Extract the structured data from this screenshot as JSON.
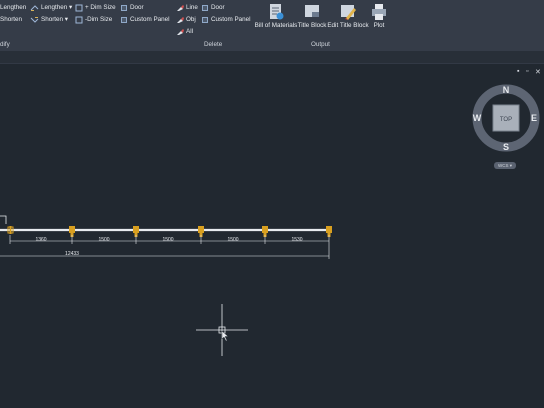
{
  "ribbon": {
    "col1": [
      "Lengthen",
      "Shorten"
    ],
    "col2": [
      "Lengthen ▾",
      "Shorten ▾"
    ],
    "col3": [
      "+ Dim Size",
      "-Dim Size"
    ],
    "col4": [
      "Door",
      "Custom Panel"
    ],
    "col5": [
      "Line",
      "Obj",
      "All"
    ],
    "col6": [
      "Door",
      "Custom Panel"
    ],
    "big_buttons": [
      "Bill of Materials",
      "Title Block",
      "Edit Title Block",
      "Plot"
    ],
    "panels": [
      "dify",
      "Delete",
      "Output"
    ]
  },
  "window_controls": [
    "▪",
    "▫",
    "✕"
  ],
  "viewcube": {
    "north": "N",
    "south": "S",
    "east": "E",
    "west": "W",
    "top_label": "TOP",
    "wcs_label": "WCS ▾"
  },
  "drawing": {
    "segment_dims": [
      "1360",
      "1500",
      "1500",
      "1500",
      "1530"
    ],
    "total_dim": "12433"
  },
  "colors": {
    "background": "#212830",
    "ribbon": "#353c48",
    "post": "#d9a020",
    "dimension": "#e8ebef"
  }
}
